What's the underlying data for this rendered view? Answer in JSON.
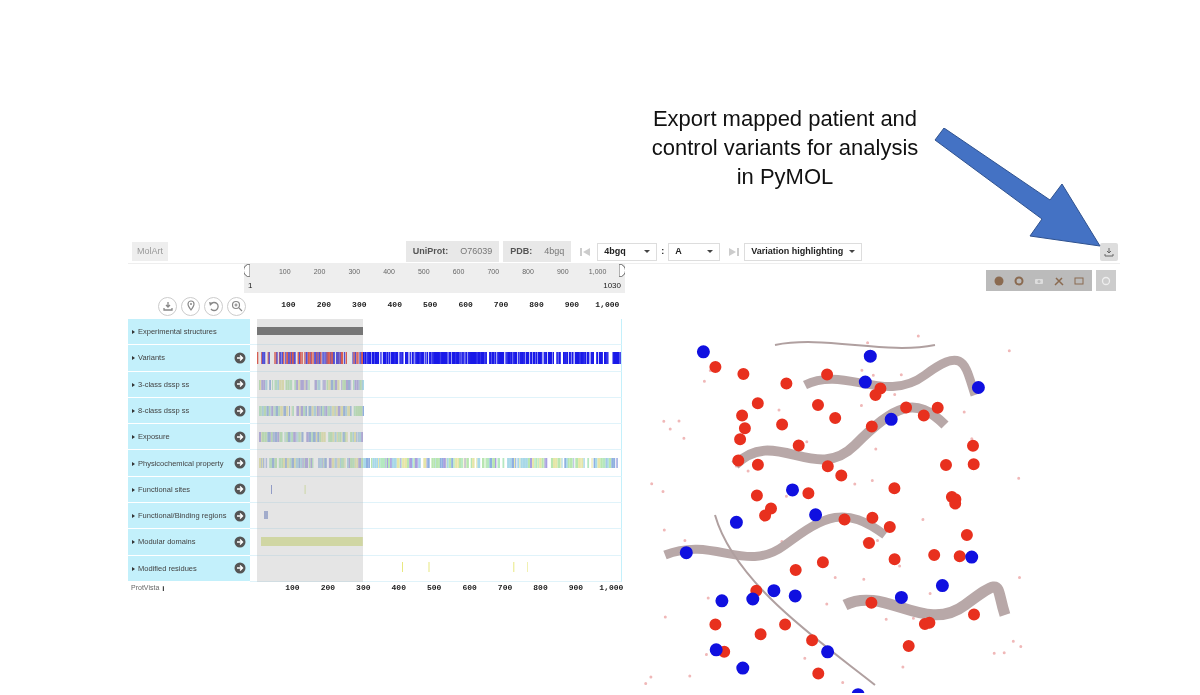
{
  "annotation": {
    "lines": [
      "Export mapped patient and",
      "control variants for analysis",
      "in PyMOL"
    ]
  },
  "header": {
    "logo": "MolArt",
    "uniprot_label": "UniProt:",
    "uniprot_id": "O76039",
    "pdb_label": "PDB:",
    "pdb_id": "4bgq",
    "structure_select": "4bgq",
    "separator": ":",
    "chain_select": "A",
    "mode_select": "Variation highlighting"
  },
  "navigator": {
    "ticks": [
      "100",
      "200",
      "300",
      "400",
      "500",
      "600",
      "700",
      "800",
      "900",
      "1,000"
    ],
    "start": "1",
    "end": "1030"
  },
  "axis_ticks": [
    "100",
    "200",
    "300",
    "400",
    "500",
    "600",
    "700",
    "800",
    "900",
    "1,000"
  ],
  "tracks": [
    {
      "label": "Experimental structures",
      "kind": "structure",
      "navigable": false
    },
    {
      "label": "Variants",
      "kind": "variants",
      "navigable": true
    },
    {
      "label": "3-class dssp ss",
      "kind": "stripes-partial",
      "navigable": true
    },
    {
      "label": "8-class dssp ss",
      "kind": "stripes-partial",
      "navigable": true
    },
    {
      "label": "Exposure",
      "kind": "stripes-partial",
      "navigable": true
    },
    {
      "label": "Physicochemical property",
      "kind": "stripes-full",
      "navigable": true
    },
    {
      "label": "Functional sites",
      "kind": "sites",
      "navigable": true
    },
    {
      "label": "Functional/Binding regions",
      "kind": "regions",
      "navigable": true
    },
    {
      "label": "Modular domains",
      "kind": "domain",
      "navigable": true
    },
    {
      "label": "Modified residues",
      "kind": "modified",
      "navigable": true
    }
  ],
  "footer": {
    "brand": "ProtVista",
    "info": "i"
  },
  "bottom_axis_ticks": [
    "100",
    "200",
    "300",
    "400",
    "500",
    "600",
    "700",
    "800",
    "900",
    "1,000"
  ]
}
